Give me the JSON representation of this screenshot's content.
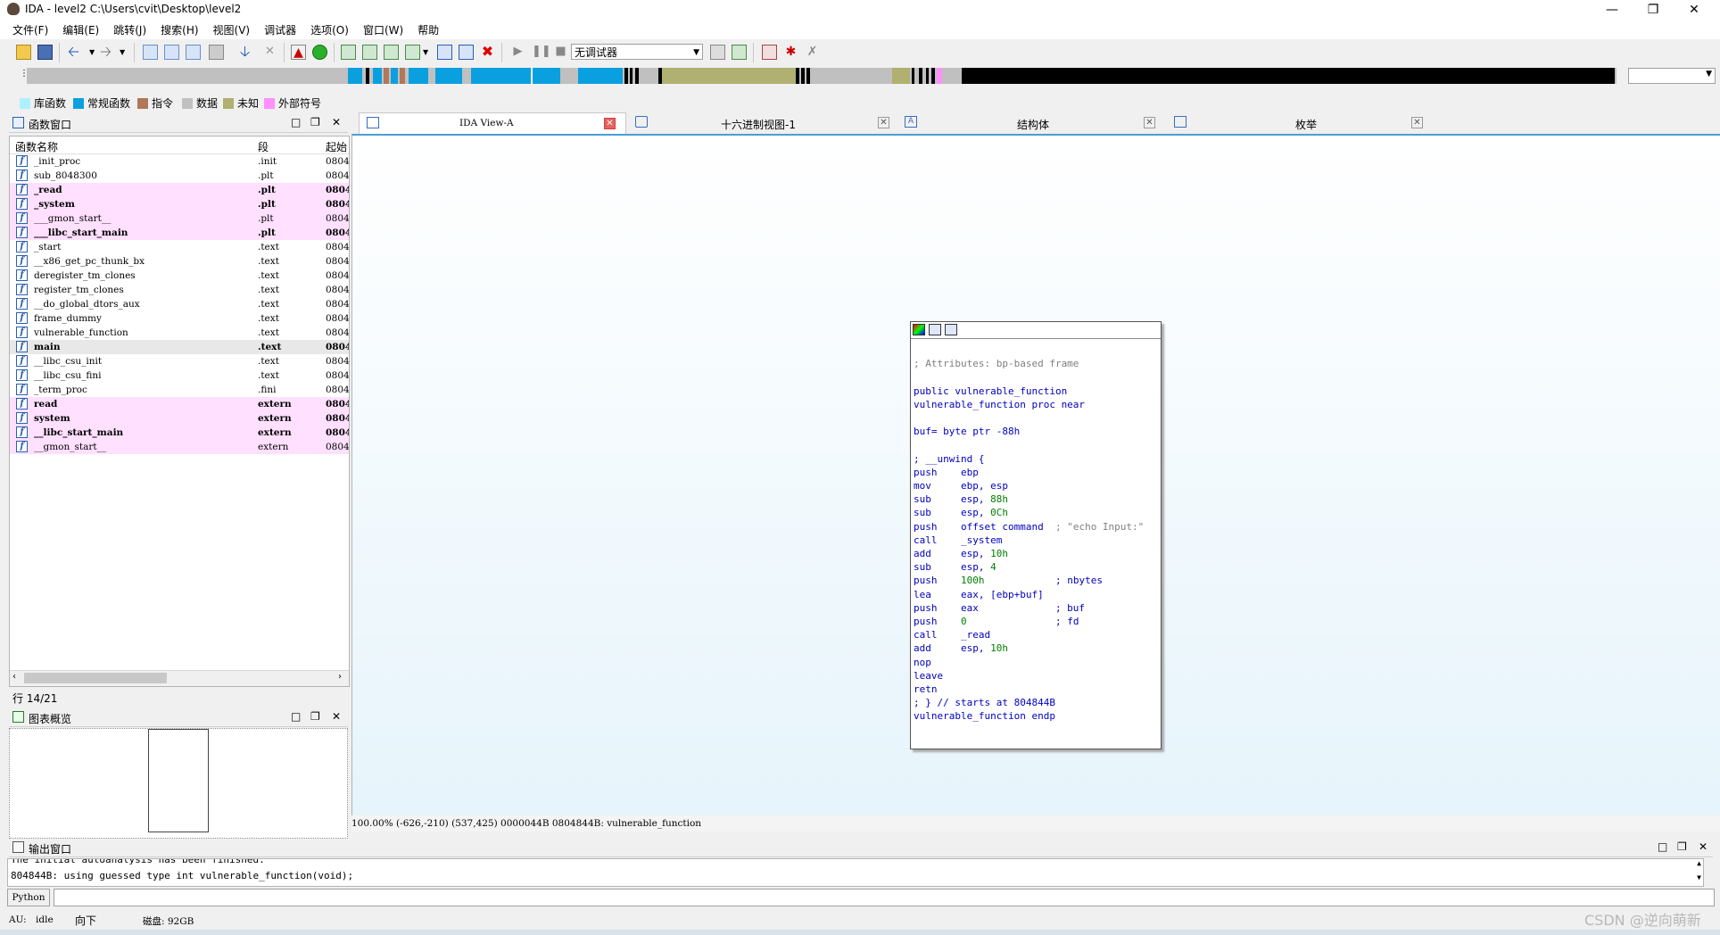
{
  "window": {
    "title": "IDA - level2 C:\\Users\\cvit\\Desktop\\level2"
  },
  "menu": [
    "文件(F)",
    "编辑(E)",
    "跳转(J)",
    "搜索(H)",
    "视图(V)",
    "调试器",
    "选项(O)",
    "窗口(W)",
    "帮助"
  ],
  "toolbar": {
    "debugger_select": "无调试器"
  },
  "legend": [
    {
      "label": "库函数",
      "color": "#aef0ff"
    },
    {
      "label": "常规函数",
      "color": "#0aa0e0"
    },
    {
      "label": "指令",
      "color": "#b07858"
    },
    {
      "label": "数据",
      "color": "#c0c0c0"
    },
    {
      "label": "未知",
      "color": "#b0b070"
    },
    {
      "label": "外部符号",
      "color": "#ff90ff"
    }
  ],
  "functions_panel": {
    "title": "函数窗口",
    "columns": [
      "函数名称",
      "段",
      "起始"
    ],
    "rows": [
      {
        "name": "_init_proc",
        "segment": ".init",
        "start": "0804",
        "style": "normal"
      },
      {
        "name": "sub_8048300",
        "segment": ".plt",
        "start": "0804",
        "style": "normal"
      },
      {
        "name": "_read",
        "segment": ".plt",
        "start": "0804",
        "style": "lib"
      },
      {
        "name": "_system",
        "segment": ".plt",
        "start": "0804",
        "style": "lib"
      },
      {
        "name": "___gmon_start__",
        "segment": ".plt",
        "start": "0804",
        "style": "libthin"
      },
      {
        "name": "___libc_start_main",
        "segment": ".plt",
        "start": "0804",
        "style": "lib"
      },
      {
        "name": "_start",
        "segment": ".text",
        "start": "0804",
        "style": "normal"
      },
      {
        "name": "__x86_get_pc_thunk_bx",
        "segment": ".text",
        "start": "0804",
        "style": "normal"
      },
      {
        "name": "deregister_tm_clones",
        "segment": ".text",
        "start": "0804",
        "style": "normal"
      },
      {
        "name": "register_tm_clones",
        "segment": ".text",
        "start": "0804",
        "style": "normal"
      },
      {
        "name": "__do_global_dtors_aux",
        "segment": ".text",
        "start": "0804",
        "style": "normal"
      },
      {
        "name": "frame_dummy",
        "segment": ".text",
        "start": "0804",
        "style": "normal"
      },
      {
        "name": "vulnerable_function",
        "segment": ".text",
        "start": "0804",
        "style": "normal"
      },
      {
        "name": "main",
        "segment": ".text",
        "start": "0804",
        "style": "sel"
      },
      {
        "name": "__libc_csu_init",
        "segment": ".text",
        "start": "0804",
        "style": "normal"
      },
      {
        "name": "__libc_csu_fini",
        "segment": ".text",
        "start": "0804",
        "style": "normal"
      },
      {
        "name": "_term_proc",
        "segment": ".fini",
        "start": "0804",
        "style": "normal"
      },
      {
        "name": "read",
        "segment": "extern",
        "start": "0804",
        "style": "lib"
      },
      {
        "name": "system",
        "segment": "extern",
        "start": "0804",
        "style": "lib"
      },
      {
        "name": "__libc_start_main",
        "segment": "extern",
        "start": "0804",
        "style": "lib"
      },
      {
        "name": "__gmon_start__",
        "segment": "extern",
        "start": "0804",
        "style": "libthin"
      }
    ],
    "row_status": "行 14/21"
  },
  "overview_panel": {
    "title": "图表概览"
  },
  "tabs": [
    {
      "label": "IDA View-A"
    },
    {
      "label": "十六进制视图-1"
    },
    {
      "label": "结构体"
    },
    {
      "label": "枚举"
    }
  ],
  "graph": {
    "status": "100.00% (-626,-210) (537,425) 0000044B 0804844B: vulnerable_function",
    "code": [
      [
        [
          "",
          ""
        ]
      ],
      [
        [
          "cmt",
          "; Attributes: bp-based frame"
        ]
      ],
      [
        [
          "",
          ""
        ]
      ],
      [
        [
          "blu",
          "public vulnerable_function"
        ]
      ],
      [
        [
          "blu",
          "vulnerable_function proc near"
        ]
      ],
      [
        [
          "",
          ""
        ]
      ],
      [
        [
          "blu",
          "buf= byte ptr -88h"
        ]
      ],
      [
        [
          "",
          ""
        ]
      ],
      [
        [
          "blu",
          "; __unwind {"
        ]
      ],
      [
        [
          "blu",
          "push    ebp"
        ]
      ],
      [
        [
          "blu",
          "mov     ebp, esp"
        ]
      ],
      [
        [
          "blu",
          "sub     esp, "
        ],
        [
          "grn",
          "88h"
        ]
      ],
      [
        [
          "blu",
          "sub     esp, "
        ],
        [
          "grn",
          "0Ch"
        ]
      ],
      [
        [
          "blu",
          "push    offset command  "
        ],
        [
          "cmt",
          "; \"echo Input:\""
        ]
      ],
      [
        [
          "blu",
          "call    _system"
        ]
      ],
      [
        [
          "blu",
          "add     esp, "
        ],
        [
          "grn",
          "10h"
        ]
      ],
      [
        [
          "blu",
          "sub     esp, "
        ],
        [
          "grn",
          "4"
        ]
      ],
      [
        [
          "blu",
          "push    "
        ],
        [
          "grn",
          "100h"
        ],
        [
          "blu",
          "            ; nbytes"
        ]
      ],
      [
        [
          "blu",
          "lea     eax, [ebp+buf]"
        ]
      ],
      [
        [
          "blu",
          "push    eax             ; buf"
        ]
      ],
      [
        [
          "blu",
          "push    "
        ],
        [
          "grn",
          "0"
        ],
        [
          "blu",
          "               ; fd"
        ]
      ],
      [
        [
          "blu",
          "call    _read"
        ]
      ],
      [
        [
          "blu",
          "add     esp, "
        ],
        [
          "grn",
          "10h"
        ]
      ],
      [
        [
          "blu",
          "nop"
        ]
      ],
      [
        [
          "blu",
          "leave"
        ]
      ],
      [
        [
          "blu",
          "retn"
        ]
      ],
      [
        [
          "blu",
          "; } // starts at 804844B"
        ]
      ],
      [
        [
          "blu",
          "vulnerable_function endp"
        ]
      ]
    ]
  },
  "output": {
    "title": "输出窗口",
    "lines": [
      "The initial autoanalysis has been finished.",
      "804844B: using guessed type int vulnerable_function(void);"
    ],
    "python_button": "Python"
  },
  "statusbar": {
    "au": "AU:",
    "state": "idle",
    "direction": "向下",
    "disk": "磁盘: 92GB"
  },
  "watermark": "CSDN @逆向萌新"
}
